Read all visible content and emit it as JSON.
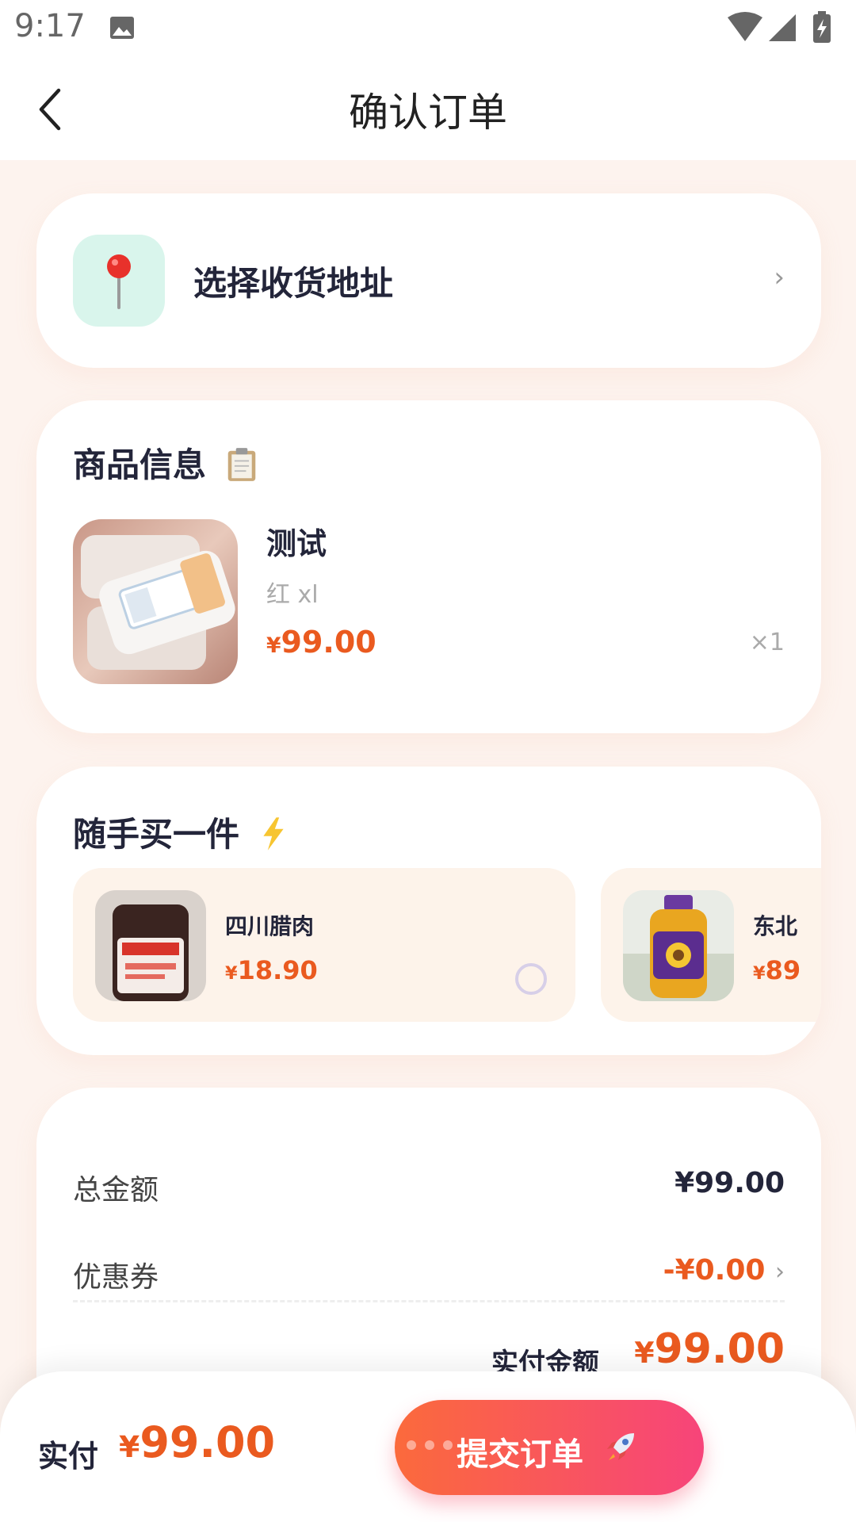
{
  "status_bar": {
    "time": "9:17"
  },
  "nav": {
    "title": "确认订单"
  },
  "address": {
    "label": "选择收货地址",
    "chevron": "›"
  },
  "product_section": {
    "title": "商品信息",
    "items": [
      {
        "name": "测试",
        "spec": "红 xl",
        "currency": "¥",
        "price": "99.00",
        "qty": "×1"
      }
    ]
  },
  "recommend": {
    "title": "随手买一件",
    "items": [
      {
        "name": "四川腊肉",
        "currency": "¥",
        "price": "18.90"
      },
      {
        "name": "东北",
        "currency": "¥",
        "price": "89"
      }
    ]
  },
  "summary": {
    "total_label": "总金额",
    "total_value": "¥99.00",
    "coupon_label": "优惠券",
    "coupon_value": "-¥0.00",
    "coupon_chevron": "›",
    "pay_label": "实付金额",
    "pay_currency": "¥",
    "pay_value": "99.00"
  },
  "bottom_bar": {
    "label": "实付",
    "currency": "¥",
    "value": "99.00",
    "submit_label": "提交订单"
  },
  "icons": {
    "back": "chevron-left-icon",
    "location": "location-pin-icon",
    "clipboard": "clipboard-icon",
    "lightning": "lightning-icon",
    "rocket": "rocket-icon"
  },
  "colors": {
    "accent": "#ea5a1f",
    "button_start": "#fb6a3c",
    "button_end": "#f7447a",
    "page_bg": "#fdf3ee"
  }
}
